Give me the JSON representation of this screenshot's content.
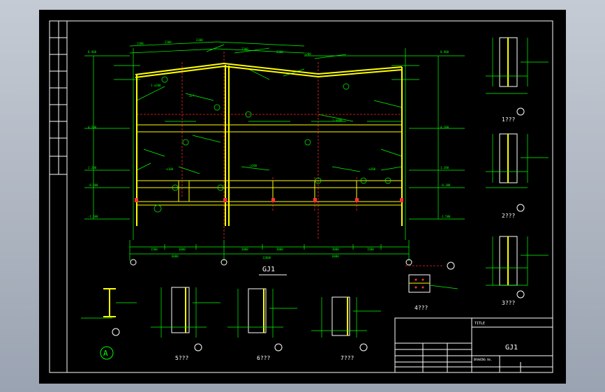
{
  "drawing": {
    "main_title": "GJ1",
    "detail_labels": [
      "1???",
      "2???",
      "3???",
      "4???",
      "5???",
      "6???",
      "7???"
    ],
    "section_mark": "A"
  },
  "title_block": {
    "project_label": "TITLE",
    "drawing_name": "GJ1",
    "drawing_no": "DRAWING No."
  },
  "colors": {
    "sheet_background": "#000000",
    "frame": "#ffffff",
    "steel_members": "#ffff00",
    "dimensions": "#00ff00",
    "hidden_lines": "#ff2222"
  }
}
